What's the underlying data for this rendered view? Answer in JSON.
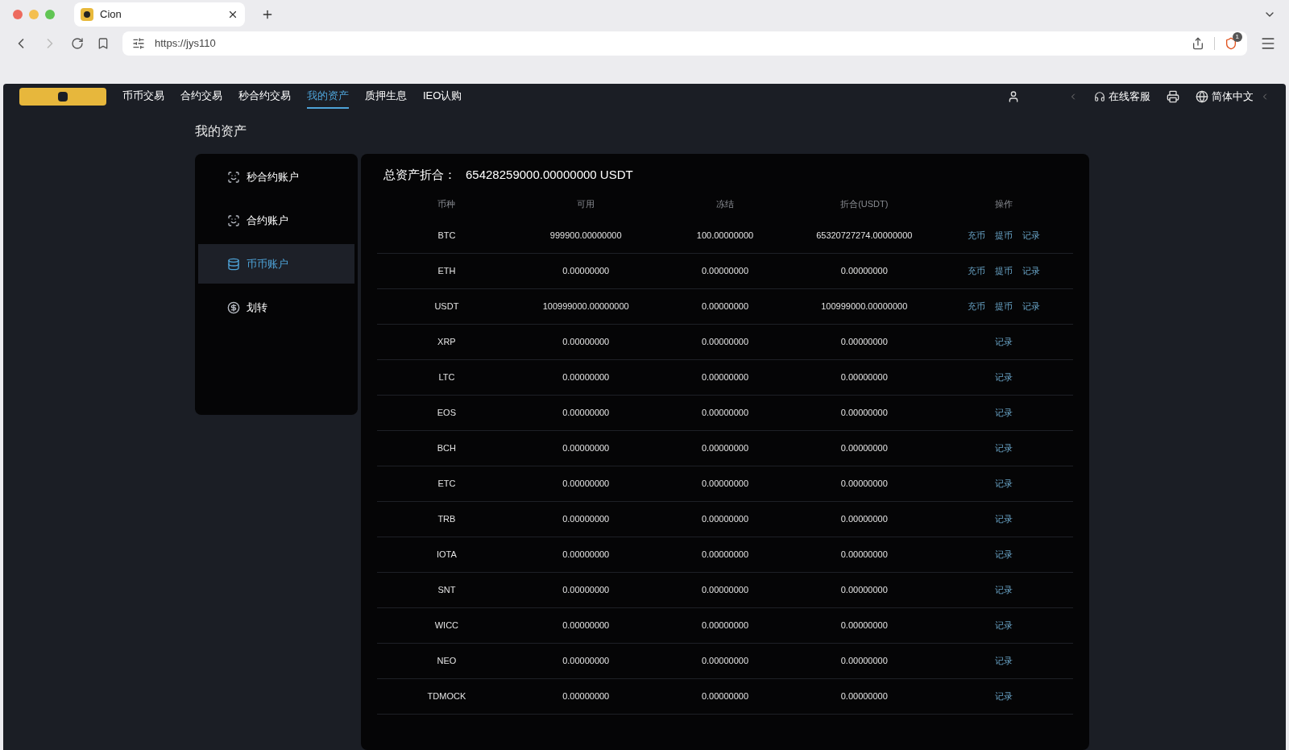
{
  "browser": {
    "tab_title": "Cion",
    "url": "https://jys110",
    "badge": "1"
  },
  "nav": {
    "items": [
      {
        "label": "币币交易",
        "selected": false
      },
      {
        "label": "合约交易",
        "selected": false
      },
      {
        "label": "秒合约交易",
        "selected": false
      },
      {
        "label": "我的资产",
        "selected": true
      },
      {
        "label": "质押生息",
        "selected": false
      },
      {
        "label": "IEO认购",
        "selected": false
      }
    ],
    "support": "在线客服",
    "language": "简体中文"
  },
  "page_title": "我的资产",
  "sidebar": [
    {
      "label": "秒合约账户",
      "kind": "frame",
      "selected": false
    },
    {
      "label": "合约账户",
      "kind": "frame",
      "selected": false
    },
    {
      "label": "币币账户",
      "kind": "database",
      "selected": true
    },
    {
      "label": "划转",
      "kind": "exchange",
      "selected": false
    }
  ],
  "total": {
    "label": "总资产折合：",
    "value": "65428259000.00000000 USDT"
  },
  "table": {
    "columns": [
      "币种",
      "可用",
      "冻结",
      "折合(USDT)",
      "操作"
    ],
    "rows": [
      {
        "cells": [
          "BTC",
          "999900.00000000",
          "100.00000000",
          "65320727274.00000000"
        ],
        "actions": [
          "充币",
          "提币",
          "记录"
        ]
      },
      {
        "cells": [
          "ETH",
          "0.00000000",
          "0.00000000",
          "0.00000000"
        ],
        "actions": [
          "充币",
          "提币",
          "记录"
        ]
      },
      {
        "cells": [
          "USDT",
          "100999000.00000000",
          "0.00000000",
          "100999000.00000000"
        ],
        "actions": [
          "充币",
          "提币",
          "记录"
        ]
      },
      {
        "cells": [
          "XRP",
          "0.00000000",
          "0.00000000",
          "0.00000000"
        ],
        "actions": [
          "记录"
        ]
      },
      {
        "cells": [
          "LTC",
          "0.00000000",
          "0.00000000",
          "0.00000000"
        ],
        "actions": [
          "记录"
        ]
      },
      {
        "cells": [
          "EOS",
          "0.00000000",
          "0.00000000",
          "0.00000000"
        ],
        "actions": [
          "记录"
        ]
      },
      {
        "cells": [
          "BCH",
          "0.00000000",
          "0.00000000",
          "0.00000000"
        ],
        "actions": [
          "记录"
        ]
      },
      {
        "cells": [
          "ETC",
          "0.00000000",
          "0.00000000",
          "0.00000000"
        ],
        "actions": [
          "记录"
        ]
      },
      {
        "cells": [
          "TRB",
          "0.00000000",
          "0.00000000",
          "0.00000000"
        ],
        "actions": [
          "记录"
        ]
      },
      {
        "cells": [
          "IOTA",
          "0.00000000",
          "0.00000000",
          "0.00000000"
        ],
        "actions": [
          "记录"
        ]
      },
      {
        "cells": [
          "SNT",
          "0.00000000",
          "0.00000000",
          "0.00000000"
        ],
        "actions": [
          "记录"
        ]
      },
      {
        "cells": [
          "WICC",
          "0.00000000",
          "0.00000000",
          "0.00000000"
        ],
        "actions": [
          "记录"
        ]
      },
      {
        "cells": [
          "NEO",
          "0.00000000",
          "0.00000000",
          "0.00000000"
        ],
        "actions": [
          "记录"
        ]
      },
      {
        "cells": [
          "TDMOCK",
          "0.00000000",
          "0.00000000",
          "0.00000000"
        ],
        "actions": [
          "记录"
        ]
      }
    ]
  }
}
